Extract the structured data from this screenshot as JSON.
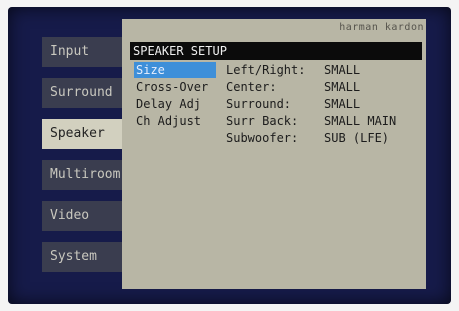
{
  "sidebar": {
    "tabs": [
      {
        "label": "Input",
        "active": false
      },
      {
        "label": "Surround",
        "active": false
      },
      {
        "label": "Speaker",
        "active": true
      },
      {
        "label": "Multiroom",
        "active": false
      },
      {
        "label": "Video",
        "active": false
      },
      {
        "label": "System",
        "active": false
      }
    ]
  },
  "panel": {
    "brand": "harman kardon",
    "title": "SPEAKER SETUP",
    "menu": [
      {
        "label": "Size",
        "selected": true
      },
      {
        "label": "Cross-Over",
        "selected": false
      },
      {
        "label": "Delay Adj",
        "selected": false
      },
      {
        "label": "Ch Adjust",
        "selected": false
      }
    ],
    "settings": [
      {
        "label": "Left/Right:",
        "value": "SMALL"
      },
      {
        "label": "Center:",
        "value": "SMALL"
      },
      {
        "label": "Surround:",
        "value": "SMALL"
      },
      {
        "label": "Surr Back:",
        "value": "SMALL MAIN"
      },
      {
        "label": "Subwoofer:",
        "value": "SUB (LFE)"
      }
    ]
  },
  "colors": {
    "screen_bg": "#161b4a",
    "panel_bg": "#b8b6a5",
    "selection": "#3e8fd9"
  }
}
